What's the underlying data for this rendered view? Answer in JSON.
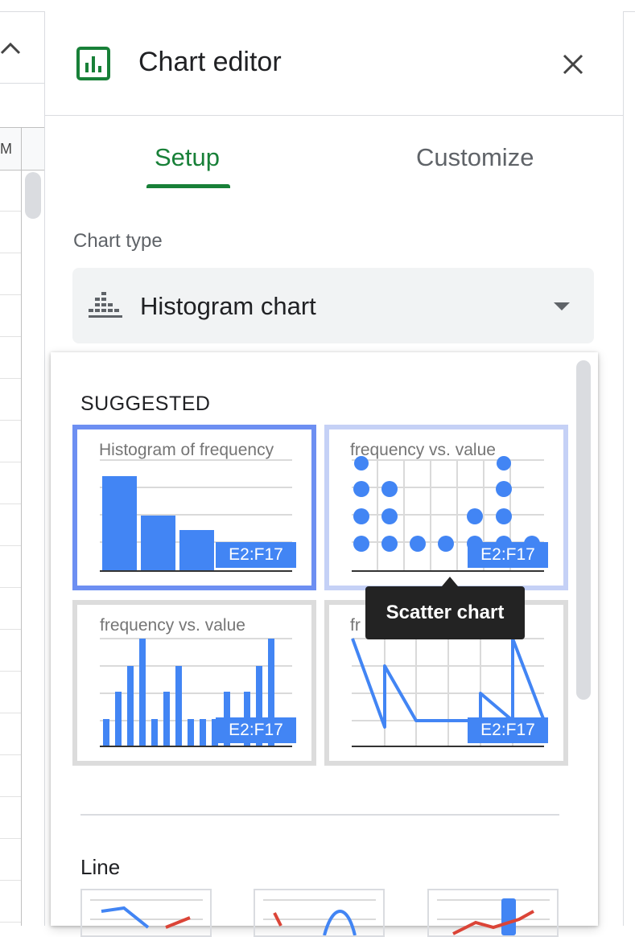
{
  "sheet": {
    "column_label": "M"
  },
  "panel": {
    "title": "Chart editor",
    "tabs": [
      {
        "label": "Setup"
      },
      {
        "label": "Customize"
      }
    ],
    "active_tab": "Setup",
    "chart_type_label": "Chart type",
    "chart_type_value": "Histogram chart"
  },
  "dropdown": {
    "section_suggested": "SUGGESTED",
    "suggestions": [
      {
        "caption": "Histogram of frequency",
        "range": "E2:F17",
        "kind": "histogram"
      },
      {
        "caption": "frequency vs. value",
        "range": "E2:F17",
        "kind": "scatter"
      },
      {
        "caption": "frequency vs. value",
        "range": "E2:F17",
        "kind": "column"
      },
      {
        "caption": "fr",
        "range": "E2:F17",
        "kind": "line"
      }
    ],
    "tooltip": "Scatter chart",
    "section_line": "Line"
  },
  "colors": {
    "accent_green": "#188038",
    "chart_blue": "#4285f4",
    "selected_border": "#6d8ff2",
    "hover_border": "#c5d1f6"
  },
  "icons": [
    "chevron-up-icon",
    "chart-editor-logo-icon",
    "close-icon",
    "histogram-icon",
    "dropdown-caret-icon"
  ]
}
